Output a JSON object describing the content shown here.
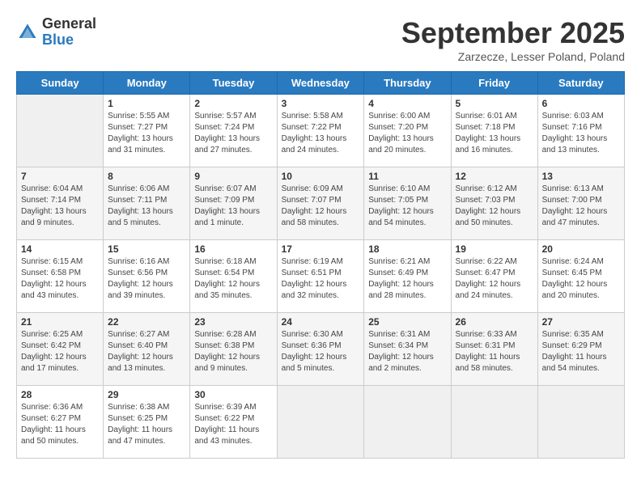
{
  "header": {
    "logo_line1": "General",
    "logo_line2": "Blue",
    "month": "September 2025",
    "location": "Zarzecze, Lesser Poland, Poland"
  },
  "days_of_week": [
    "Sunday",
    "Monday",
    "Tuesday",
    "Wednesday",
    "Thursday",
    "Friday",
    "Saturday"
  ],
  "weeks": [
    [
      {
        "day": "",
        "info": ""
      },
      {
        "day": "1",
        "info": "Sunrise: 5:55 AM\nSunset: 7:27 PM\nDaylight: 13 hours and 31 minutes."
      },
      {
        "day": "2",
        "info": "Sunrise: 5:57 AM\nSunset: 7:24 PM\nDaylight: 13 hours and 27 minutes."
      },
      {
        "day": "3",
        "info": "Sunrise: 5:58 AM\nSunset: 7:22 PM\nDaylight: 13 hours and 24 minutes."
      },
      {
        "day": "4",
        "info": "Sunrise: 6:00 AM\nSunset: 7:20 PM\nDaylight: 13 hours and 20 minutes."
      },
      {
        "day": "5",
        "info": "Sunrise: 6:01 AM\nSunset: 7:18 PM\nDaylight: 13 hours and 16 minutes."
      },
      {
        "day": "6",
        "info": "Sunrise: 6:03 AM\nSunset: 7:16 PM\nDaylight: 13 hours and 13 minutes."
      }
    ],
    [
      {
        "day": "7",
        "info": "Sunrise: 6:04 AM\nSunset: 7:14 PM\nDaylight: 13 hours and 9 minutes."
      },
      {
        "day": "8",
        "info": "Sunrise: 6:06 AM\nSunset: 7:11 PM\nDaylight: 13 hours and 5 minutes."
      },
      {
        "day": "9",
        "info": "Sunrise: 6:07 AM\nSunset: 7:09 PM\nDaylight: 13 hours and 1 minute."
      },
      {
        "day": "10",
        "info": "Sunrise: 6:09 AM\nSunset: 7:07 PM\nDaylight: 12 hours and 58 minutes."
      },
      {
        "day": "11",
        "info": "Sunrise: 6:10 AM\nSunset: 7:05 PM\nDaylight: 12 hours and 54 minutes."
      },
      {
        "day": "12",
        "info": "Sunrise: 6:12 AM\nSunset: 7:03 PM\nDaylight: 12 hours and 50 minutes."
      },
      {
        "day": "13",
        "info": "Sunrise: 6:13 AM\nSunset: 7:00 PM\nDaylight: 12 hours and 47 minutes."
      }
    ],
    [
      {
        "day": "14",
        "info": "Sunrise: 6:15 AM\nSunset: 6:58 PM\nDaylight: 12 hours and 43 minutes."
      },
      {
        "day": "15",
        "info": "Sunrise: 6:16 AM\nSunset: 6:56 PM\nDaylight: 12 hours and 39 minutes."
      },
      {
        "day": "16",
        "info": "Sunrise: 6:18 AM\nSunset: 6:54 PM\nDaylight: 12 hours and 35 minutes."
      },
      {
        "day": "17",
        "info": "Sunrise: 6:19 AM\nSunset: 6:51 PM\nDaylight: 12 hours and 32 minutes."
      },
      {
        "day": "18",
        "info": "Sunrise: 6:21 AM\nSunset: 6:49 PM\nDaylight: 12 hours and 28 minutes."
      },
      {
        "day": "19",
        "info": "Sunrise: 6:22 AM\nSunset: 6:47 PM\nDaylight: 12 hours and 24 minutes."
      },
      {
        "day": "20",
        "info": "Sunrise: 6:24 AM\nSunset: 6:45 PM\nDaylight: 12 hours and 20 minutes."
      }
    ],
    [
      {
        "day": "21",
        "info": "Sunrise: 6:25 AM\nSunset: 6:42 PM\nDaylight: 12 hours and 17 minutes."
      },
      {
        "day": "22",
        "info": "Sunrise: 6:27 AM\nSunset: 6:40 PM\nDaylight: 12 hours and 13 minutes."
      },
      {
        "day": "23",
        "info": "Sunrise: 6:28 AM\nSunset: 6:38 PM\nDaylight: 12 hours and 9 minutes."
      },
      {
        "day": "24",
        "info": "Sunrise: 6:30 AM\nSunset: 6:36 PM\nDaylight: 12 hours and 5 minutes."
      },
      {
        "day": "25",
        "info": "Sunrise: 6:31 AM\nSunset: 6:34 PM\nDaylight: 12 hours and 2 minutes."
      },
      {
        "day": "26",
        "info": "Sunrise: 6:33 AM\nSunset: 6:31 PM\nDaylight: 11 hours and 58 minutes."
      },
      {
        "day": "27",
        "info": "Sunrise: 6:35 AM\nSunset: 6:29 PM\nDaylight: 11 hours and 54 minutes."
      }
    ],
    [
      {
        "day": "28",
        "info": "Sunrise: 6:36 AM\nSunset: 6:27 PM\nDaylight: 11 hours and 50 minutes."
      },
      {
        "day": "29",
        "info": "Sunrise: 6:38 AM\nSunset: 6:25 PM\nDaylight: 11 hours and 47 minutes."
      },
      {
        "day": "30",
        "info": "Sunrise: 6:39 AM\nSunset: 6:22 PM\nDaylight: 11 hours and 43 minutes."
      },
      {
        "day": "",
        "info": ""
      },
      {
        "day": "",
        "info": ""
      },
      {
        "day": "",
        "info": ""
      },
      {
        "day": "",
        "info": ""
      }
    ]
  ]
}
